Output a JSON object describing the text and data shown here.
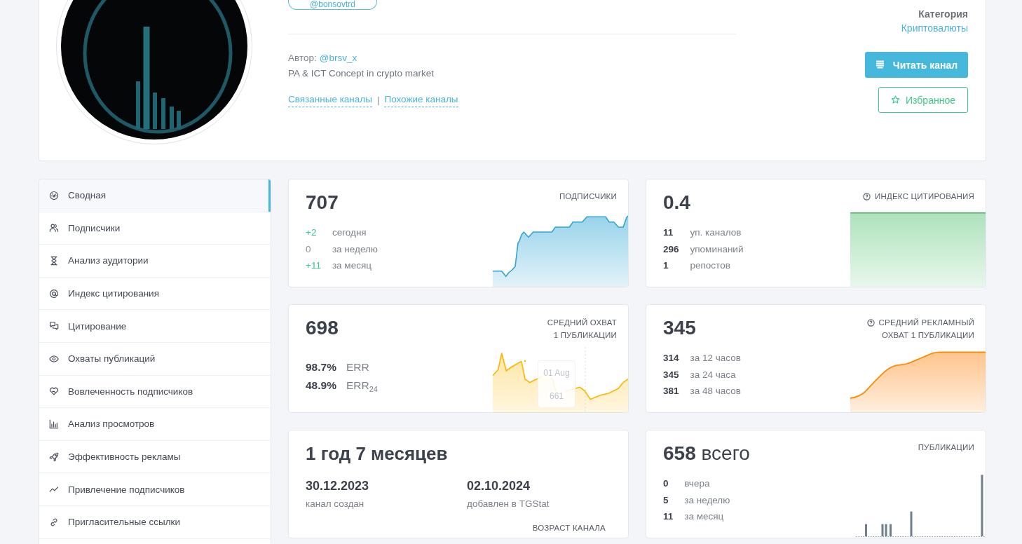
{
  "header": {
    "handle": "@bonsovtrd",
    "author_label": "Автор:",
    "author": "@brsv_x",
    "description": "PA & ICT Concept in crypto market",
    "links": [
      "Связанные каналы",
      "Похожие каналы"
    ],
    "separator": "|",
    "category_label": "Категория",
    "category": "Криптовалюты",
    "buttons": [
      {
        "label": "Читать канал",
        "kind": "primary"
      },
      {
        "label": "Избранное",
        "kind": "outline"
      }
    ]
  },
  "sidebar": {
    "items": [
      {
        "label": "Сводная",
        "selected": true
      },
      {
        "label": "Подписчики",
        "selected": false
      },
      {
        "label": "Анализ аудитории",
        "selected": false
      },
      {
        "label": "Индекс цитирования",
        "selected": false
      },
      {
        "label": "Цитирование",
        "selected": false
      },
      {
        "label": "Охваты публикаций",
        "selected": false
      },
      {
        "label": "Вовлеченность подписчиков",
        "selected": false
      },
      {
        "label": "Анализ просмотров",
        "selected": false
      },
      {
        "label": "Эффективность рекламы",
        "selected": false
      },
      {
        "label": "Привлечение подписчиков",
        "selected": false
      },
      {
        "label": "Пригласительные ссылки",
        "selected": false
      }
    ]
  },
  "cards": [
    {
      "kind": "subscribers",
      "value": "707",
      "title": [
        "ПОДПИСЧИКИ"
      ],
      "help": false,
      "stats": [
        {
          "value": "+2",
          "label": "сегодня",
          "kind": "gain"
        },
        {
          "value": "0",
          "label": "за неделю",
          "kind": "flat"
        },
        {
          "value": "+11",
          "label": "за месяц",
          "kind": "gain"
        }
      ]
    },
    {
      "kind": "citation",
      "value": "0.4",
      "title": [
        "ИНДЕКС ЦИТИРОВАНИЯ"
      ],
      "help": true,
      "stats": [
        {
          "value": "11",
          "label": "уп. каналов",
          "kind": "count"
        },
        {
          "value": "296",
          "label": "упоминаний",
          "kind": "count"
        },
        {
          "value": "1",
          "label": "репостов",
          "kind": "count"
        }
      ]
    },
    {
      "kind": "reach",
      "value": "698",
      "title": [
        "СРЕДНИЙ ОХВАТ",
        "1 ПУБЛИКАЦИИ"
      ],
      "help": false,
      "stats": [
        {
          "value": "98.7%",
          "label": "ERR",
          "kind": "count"
        },
        {
          "value": "48.9%",
          "label": "ERR$_{24}$",
          "kind": "count"
        }
      ],
      "tooltip": {
        "date": "01 Aug",
        "value": "661"
      }
    },
    {
      "kind": "ad_reach",
      "value": "345",
      "title": [
        "СРЕДНИЙ РЕКЛАМНЫЙ",
        "ОХВАТ 1 ПУБЛИКАЦИИ"
      ],
      "help": true,
      "stats": [
        {
          "value": "314",
          "label": "за 12 часов",
          "kind": "count"
        },
        {
          "value": "345",
          "label": "за 24 часа",
          "kind": "count"
        },
        {
          "value": "381",
          "label": "за 48 часов",
          "kind": "count"
        }
      ]
    },
    {
      "kind": "age",
      "value": "1 год 7 месяцев",
      "title": [
        "ВОЗРАСТ КАНАЛА"
      ],
      "dates": [
        {
          "value": "30.12.2023",
          "label": "канал создан"
        },
        {
          "value": "02.10.2024",
          "label": "добавлен в TGStat"
        }
      ]
    },
    {
      "kind": "posts",
      "value": "**658** всего",
      "title": [
        "ПУБЛИКАЦИИ"
      ],
      "help": false,
      "stats": [
        {
          "value": "0",
          "label": "вчера",
          "kind": "count"
        },
        {
          "value": "5",
          "label": "за неделю",
          "kind": "count"
        },
        {
          "value": "11",
          "label": "за месяц",
          "kind": "count"
        }
      ]
    }
  ]
}
